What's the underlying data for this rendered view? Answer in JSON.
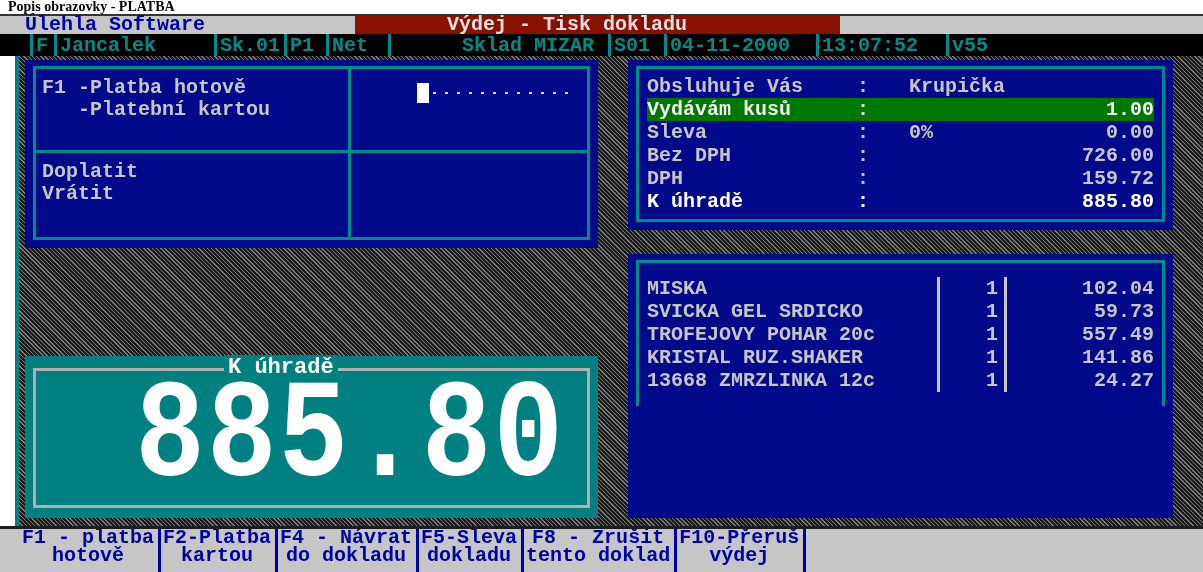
{
  "caption": "Popis obrazovky - PLATBA",
  "title_bar": {
    "app": "Úlehla Software",
    "title": "Výdej - Tisk dokladu"
  },
  "status_bar": [
    "F",
    "Jancalek",
    "Sk.01",
    "P1",
    "Net",
    "Sklad MIZAR",
    "S01",
    "04-11-2000",
    "13:07:52",
    "v55"
  ],
  "payment_panel": {
    "options": [
      {
        "key": "F1",
        "label": "-Platba hotově"
      },
      {
        "label": "-Platební kartou"
      }
    ],
    "labels": [
      "Doplatit",
      "Vrátit"
    ]
  },
  "summary": {
    "rows": [
      {
        "label": "Obsluhuje Vás",
        "separator": ":",
        "middle": "Krupička",
        "selected": false,
        "emphasized": false
      },
      {
        "label": "Vydávám kusů",
        "separator": ":",
        "value": "1.00",
        "selected": true,
        "emphasized": false
      },
      {
        "label": "Sleva",
        "separator": ":",
        "middle": "0%",
        "value": "0.00",
        "selected": false,
        "emphasized": false
      },
      {
        "label": "Bez DPH",
        "separator": ":",
        "value": "726.00",
        "selected": false,
        "emphasized": false
      },
      {
        "label": "DPH",
        "separator": ":",
        "value": "159.72",
        "selected": false,
        "emphasized": false
      },
      {
        "label": "K úhradě",
        "separator": ":",
        "value": "885.80",
        "selected": false,
        "emphasized": true
      }
    ]
  },
  "items": [
    {
      "name": "MISKA",
      "qty": "1",
      "price": "102.04"
    },
    {
      "name": "SVICKA GEL SRDICKO",
      "qty": "1",
      "price": "59.73"
    },
    {
      "name": "TROFEJOVY POHAR 20c",
      "qty": "1",
      "price": "557.49"
    },
    {
      "name": "KRISTAL RUZ.SHAKER",
      "qty": "1",
      "price": "141.86"
    },
    {
      "name": "13668 ZMRZLINKA 12c",
      "qty": "1",
      "price": "24.27"
    }
  ],
  "total_display": {
    "title": "K úhradě",
    "amount": "885.80"
  },
  "function_keys": [
    {
      "line1": "F1 - platba",
      "line2": "hotově"
    },
    {
      "line1": "F2-Platba",
      "line2": "kartou"
    },
    {
      "line1": "F4 - Návrat",
      "line2": "do dokladu"
    },
    {
      "line1": "F5-Sleva",
      "line2": "dokladu"
    },
    {
      "line1": "F8 - Zrušit",
      "line2": "tento doklad"
    },
    {
      "line1": "F10-Přeruš",
      "line2": "výdej"
    }
  ]
}
